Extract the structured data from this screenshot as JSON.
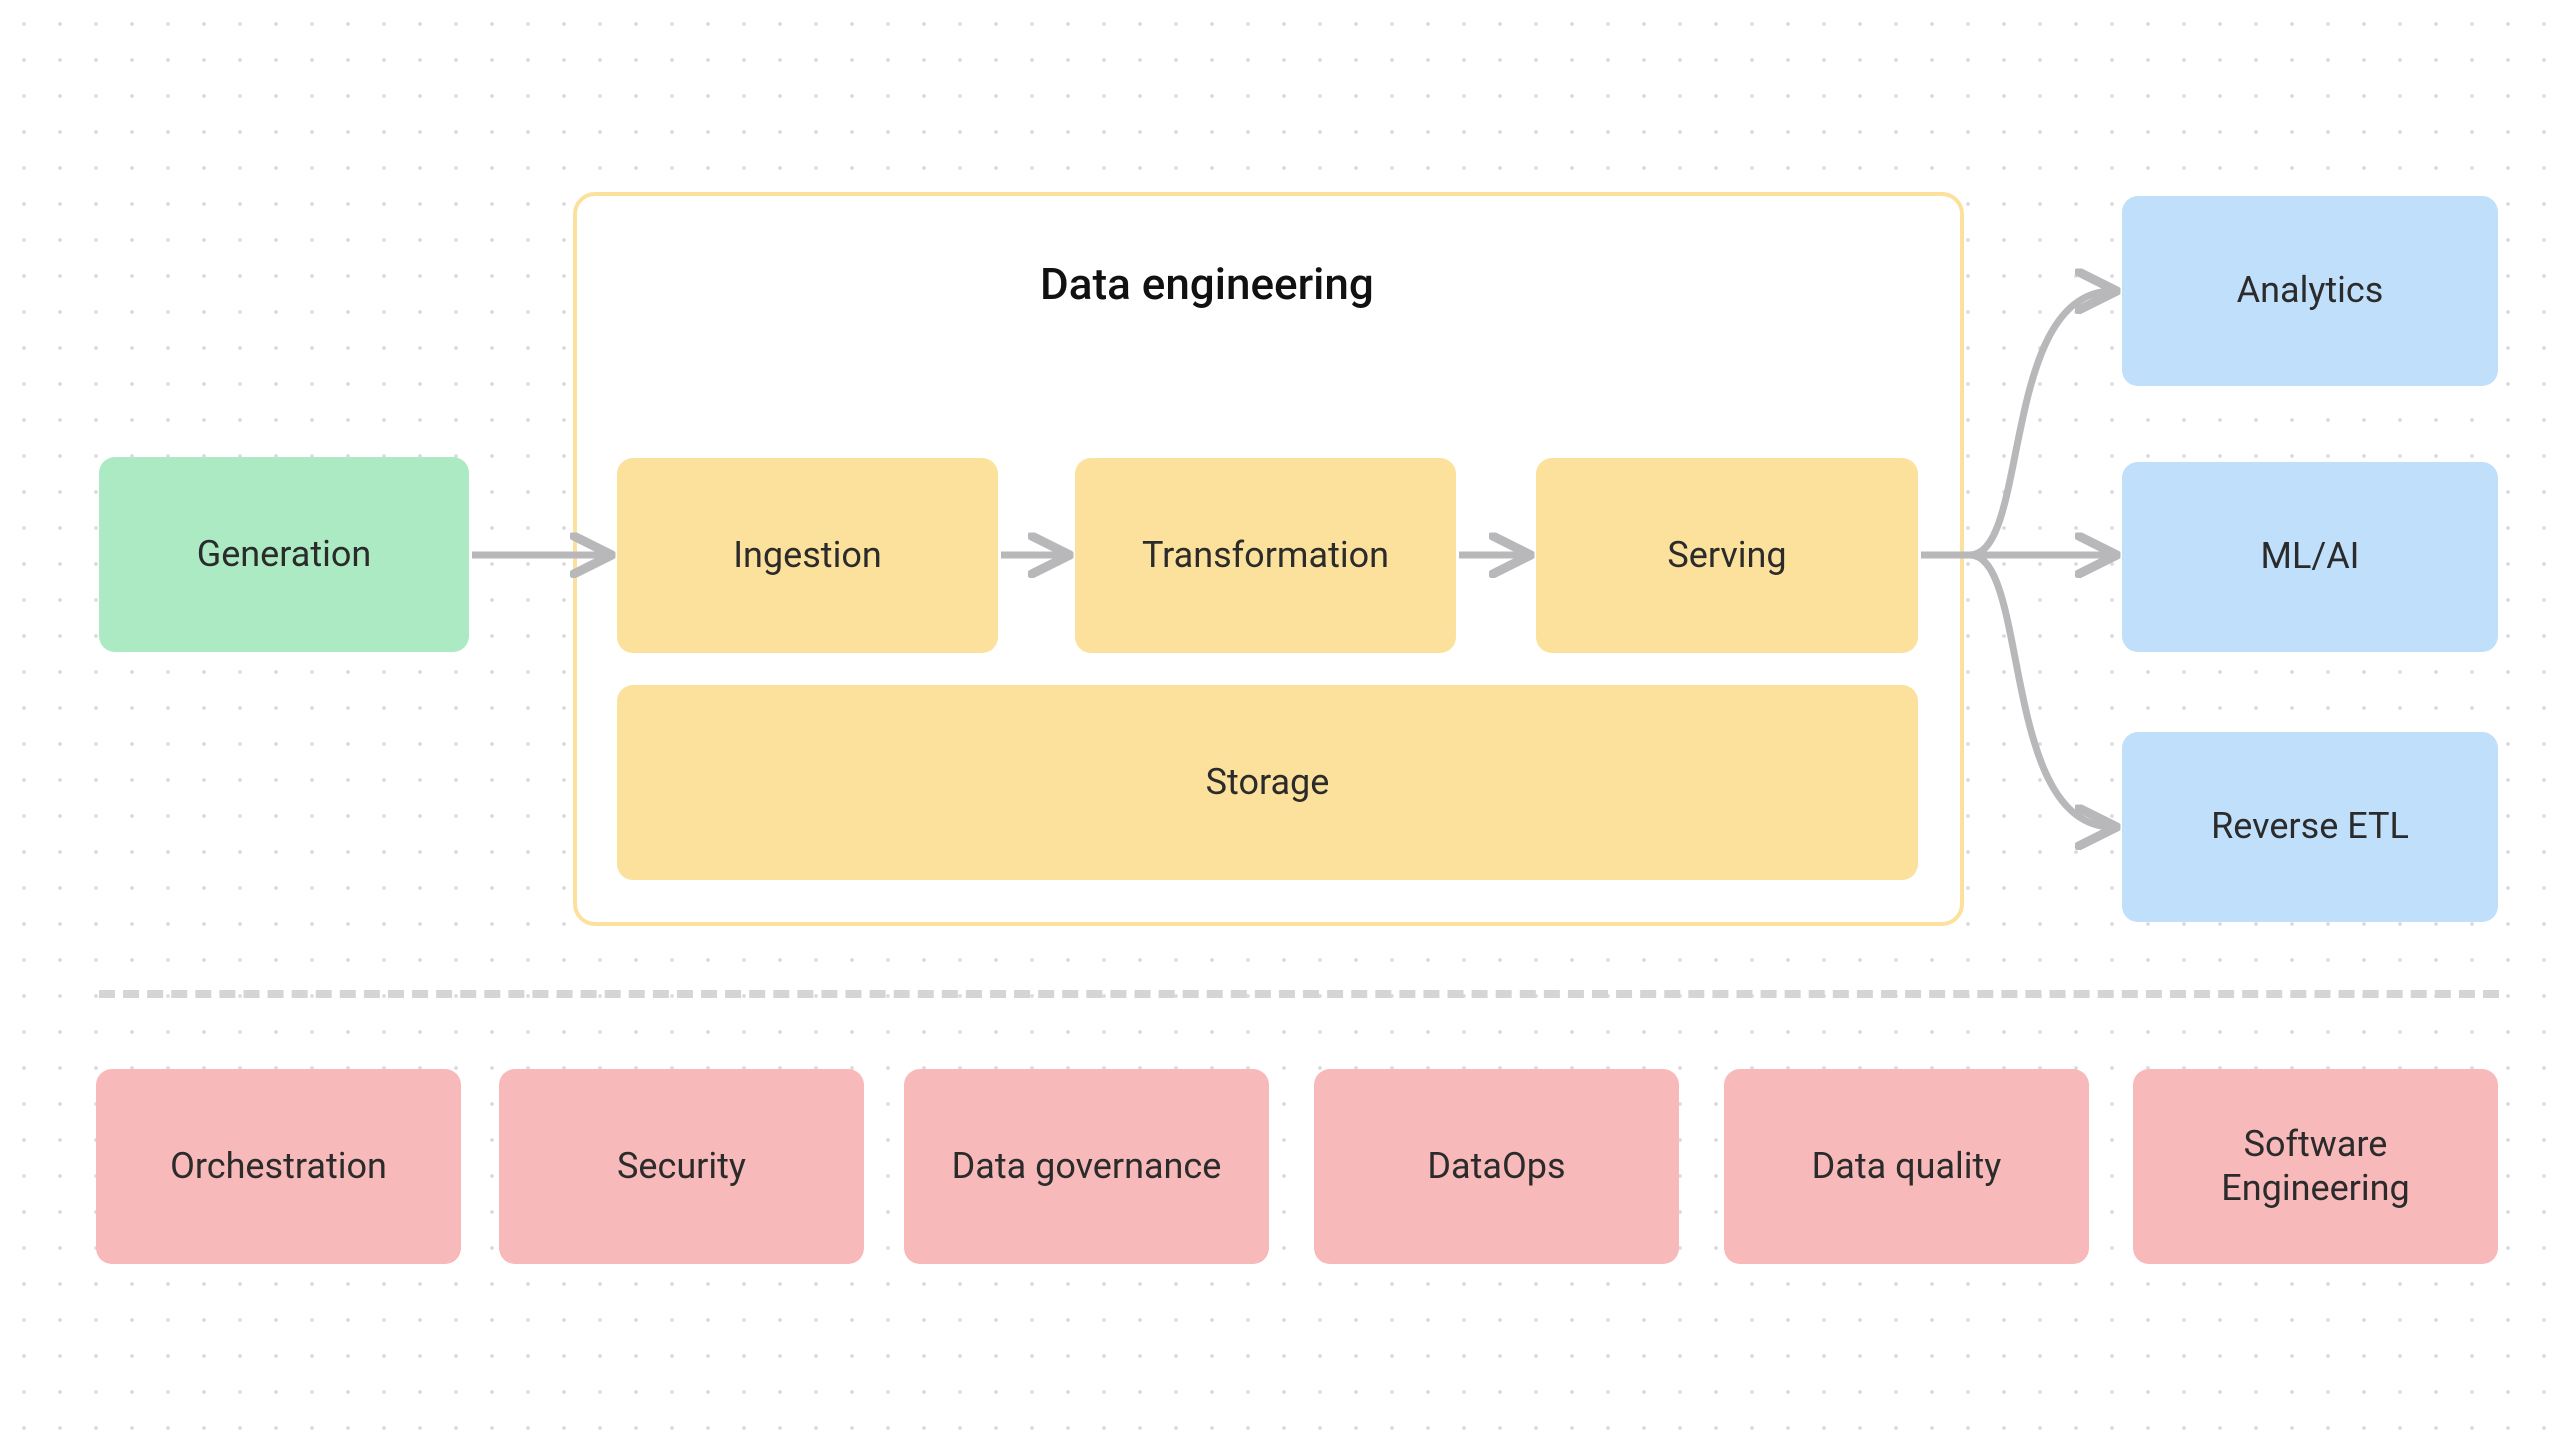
{
  "de_title": "Data engineering",
  "generation": "Generation",
  "ingestion": "Ingestion",
  "transformation": "Transformation",
  "serving": "Serving",
  "storage": "Storage",
  "analytics": "Analytics",
  "mlai": "ML/AI",
  "reverse_etl": "Reverse ETL",
  "orchestration": "Orchestration",
  "security": "Security",
  "data_governance": "Data governance",
  "dataops": "DataOps",
  "data_quality": "Data quality",
  "software_engineering": "Software Engineering"
}
